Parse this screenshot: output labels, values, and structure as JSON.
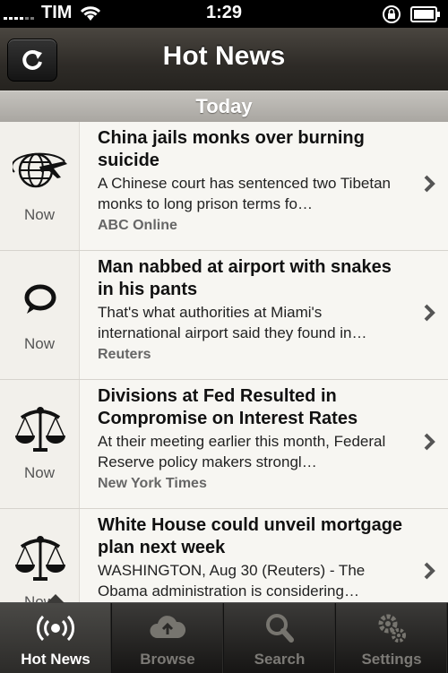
{
  "status_bar": {
    "carrier": "TIM",
    "time": "1:29"
  },
  "nav": {
    "title": "Hot News"
  },
  "section": {
    "header": "Today"
  },
  "items": [
    {
      "icon": "airplane-globe-icon",
      "time": "Now",
      "title": "China jails monks over burning suicide",
      "desc": "A Chinese court has sentenced two Tibetan monks to long prison terms fo…",
      "source": "ABC Online"
    },
    {
      "icon": "speech-bubble-icon",
      "time": "Now",
      "title": "Man nabbed at airport with snakes in his pants",
      "desc": "That's what authorities at Miami's international airport said they found in…",
      "source": "Reuters"
    },
    {
      "icon": "scales-icon",
      "time": "Now",
      "title": "Divisions at Fed Resulted in Compromise on Interest Rates",
      "desc": "At their meeting earlier this month, Federal Reserve policy makers strongl…",
      "source": "New York Times"
    },
    {
      "icon": "scales-icon",
      "time": "Now",
      "title": "White House could unveil mortgage plan next week",
      "desc": "WASHINGTON, Aug 30 (Reuters) - The Obama administration is considering…",
      "source": ""
    }
  ],
  "tabs": [
    {
      "label": "Hot News",
      "icon": "broadcast-icon",
      "active": true
    },
    {
      "label": "Browse",
      "icon": "cloud-icon",
      "active": false
    },
    {
      "label": "Search",
      "icon": "magnifier-icon",
      "active": false
    },
    {
      "label": "Settings",
      "icon": "gears-icon",
      "active": false
    }
  ]
}
